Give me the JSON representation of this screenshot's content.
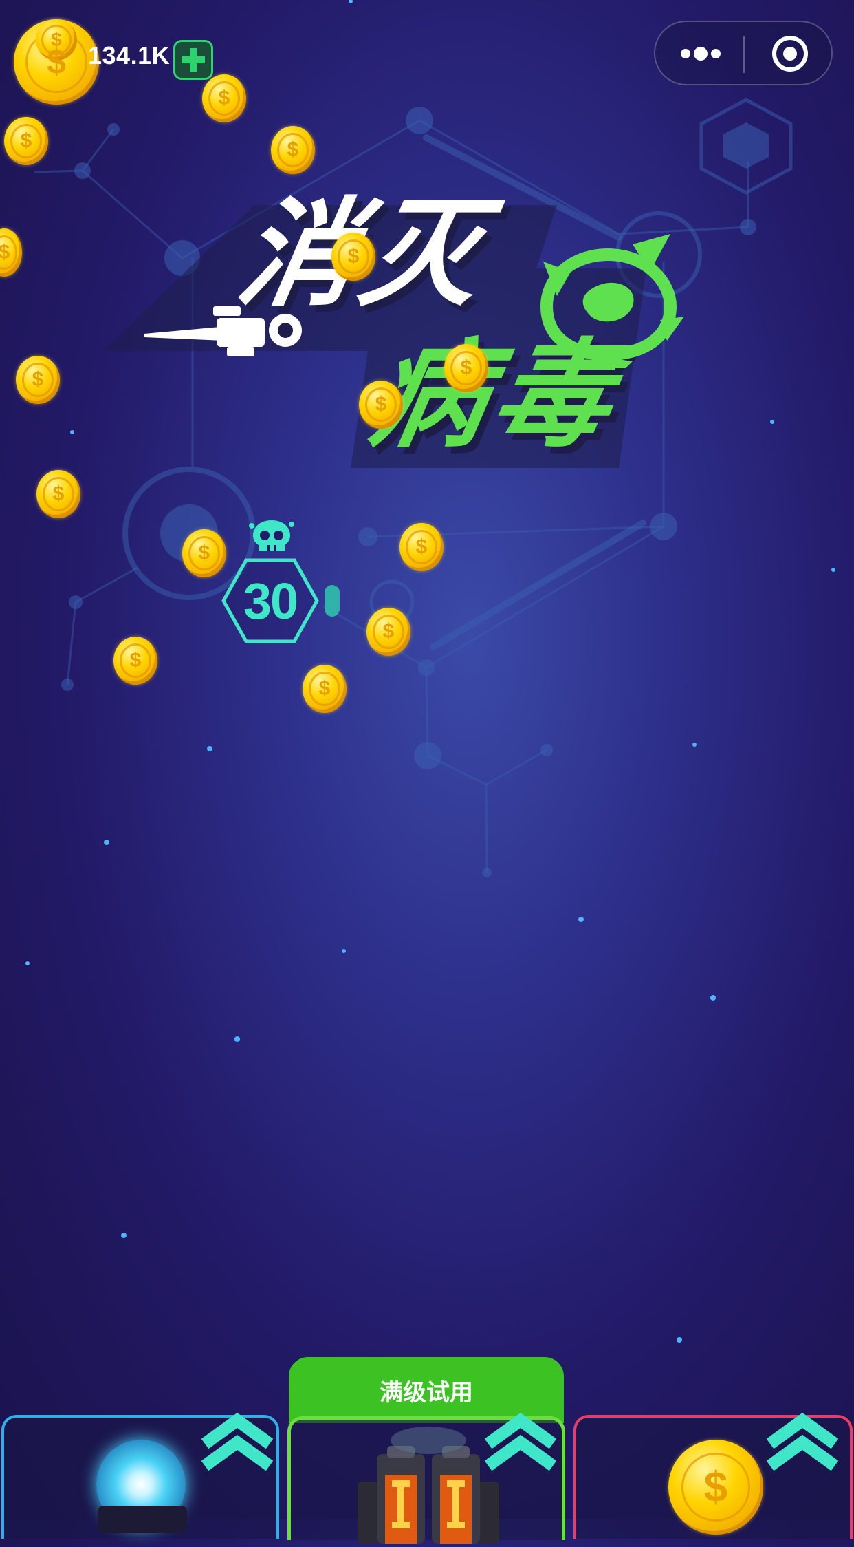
{
  "header": {
    "coin_balance": "134.1K",
    "add_symbol": "+"
  },
  "title": {
    "line1": "消灭",
    "line2": "病毒"
  },
  "level": {
    "number": "30"
  },
  "shop": {
    "trial_label": "满级试用"
  },
  "coin_symbol": "$",
  "colors": {
    "accent_green": "#5ee04f",
    "teal": "#3fe6c7",
    "coin_gold": "#ffd400",
    "card_blue": "#2bb0e8",
    "card_green": "#6ce03a",
    "card_red": "#e83c6a"
  },
  "icons": [
    "more-icon",
    "close-mini-program-icon",
    "virus-skull-icon",
    "upgrade-chevron-icon",
    "plus-icon"
  ]
}
